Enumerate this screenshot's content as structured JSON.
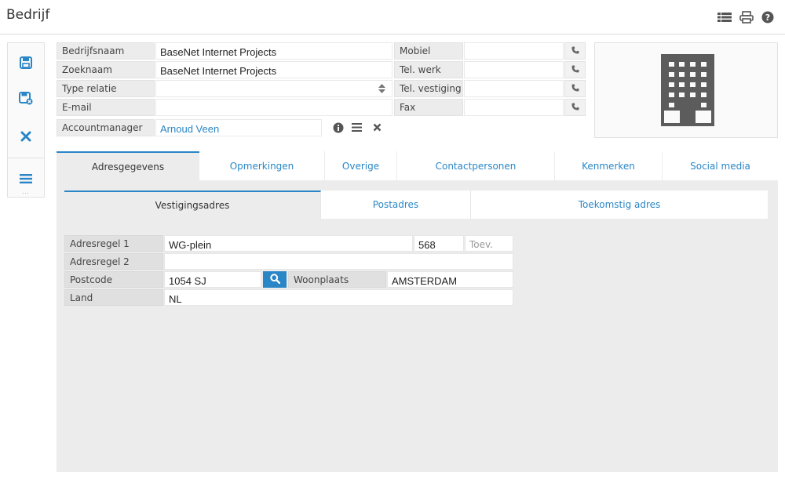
{
  "header": {
    "title": "Bedrijf"
  },
  "header_icons": [
    "list-icon",
    "print-icon",
    "help-icon"
  ],
  "toolbar": [
    "save-icon",
    "save-close-icon",
    "cancel-icon",
    "menu-icon"
  ],
  "form": {
    "bedrijfsnaam_label": "Bedrijfsnaam",
    "bedrijfsnaam_value": "BaseNet Internet Projects",
    "zoeknaam_label": "Zoeknaam",
    "zoeknaam_value": "BaseNet Internet Projects",
    "type_relatie_label": "Type relatie",
    "type_relatie_value": "",
    "email_label": "E-mail",
    "email_value": "",
    "accountmanager_label": "Accountmanager",
    "accountmanager_value": "Arnoud Veen"
  },
  "phones": {
    "mobiel_label": "Mobiel",
    "tel_werk_label": "Tel. werk",
    "tel_vestiging_label": "Tel. vestiging",
    "fax_label": "Fax"
  },
  "tabs": [
    "Adresgegevens",
    "Opmerkingen",
    "Overige",
    "Contactpersonen",
    "Kenmerken",
    "Social media"
  ],
  "subtabs": [
    "Vestigingsadres",
    "Postadres",
    "Toekomstig adres"
  ],
  "address": {
    "adresregel1_label": "Adresregel 1",
    "adresregel1_value": "WG-plein",
    "huisnummer_value": "568",
    "toev_placeholder": "Toev.",
    "adresregel2_label": "Adresregel 2",
    "adresregel2_value": "",
    "postcode_label": "Postcode",
    "postcode_value": "1054 SJ",
    "woonplaats_label": "Woonplaats",
    "woonplaats_value": "AMSTERDAM",
    "land_label": "Land",
    "land_value": "NL"
  },
  "colors": {
    "accent": "#2a86c6",
    "panel": "#ececec",
    "icon": "#2a86c6",
    "icon_dark": "#555555"
  }
}
